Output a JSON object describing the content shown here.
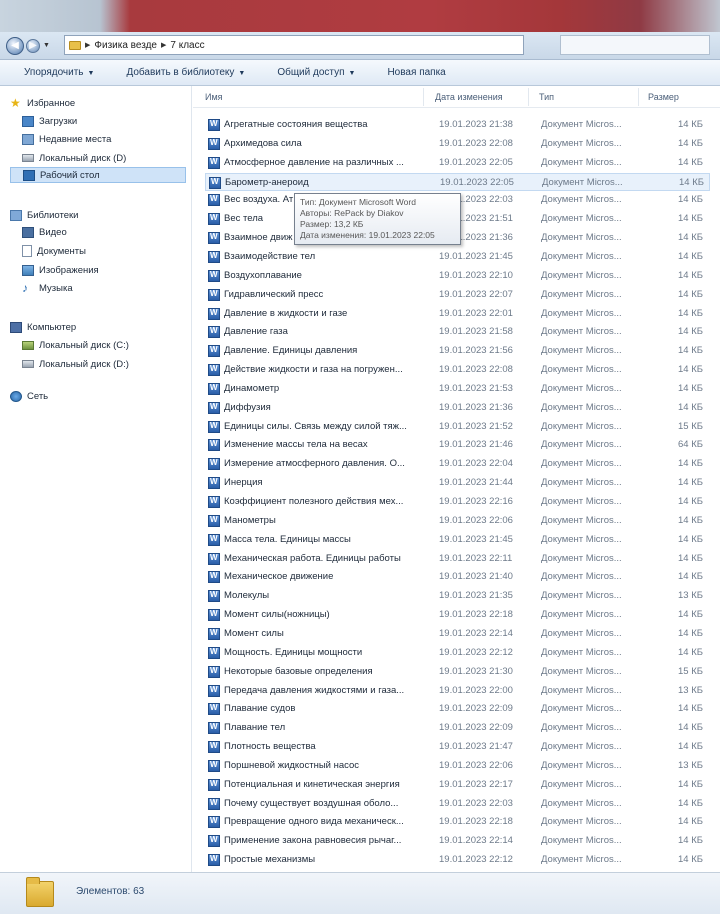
{
  "breadcrumb": {
    "parts": [
      "Физика везде",
      "7 класс"
    ]
  },
  "toolbar": {
    "organize": "Упорядочить",
    "add_library": "Добавить в библиотеку",
    "share": "Общий доступ",
    "new_folder": "Новая папка"
  },
  "sidebar": {
    "favorites": {
      "header": "Избранное",
      "items": [
        "Загрузки",
        "Недавние места",
        "Локальный диск (D)",
        "Рабочий стол"
      ]
    },
    "libraries": {
      "header": "Библиотеки",
      "items": [
        "Видео",
        "Документы",
        "Изображения",
        "Музыка"
      ]
    },
    "computer": {
      "header": "Компьютер",
      "items": [
        "Локальный диск (C:)",
        "Локальный диск (D:)"
      ]
    },
    "network": {
      "header": "Сеть"
    }
  },
  "columns": {
    "name": "Имя",
    "date": "Дата изменения",
    "type": "Тип",
    "size": "Размер"
  },
  "files": [
    {
      "name": "Агрегатные состояния вещества",
      "date": "19.01.2023 21:38",
      "type": "Документ Micros...",
      "size": "14 КБ"
    },
    {
      "name": "Архимедова сила",
      "date": "19.01.2023 22:08",
      "type": "Документ Micros...",
      "size": "14 КБ"
    },
    {
      "name": "Атмосферное давление на различных ...",
      "date": "19.01.2023 22:05",
      "type": "Документ Micros...",
      "size": "14 КБ"
    },
    {
      "name": "Барометр-анероид",
      "date": "19.01.2023 22:05",
      "type": "Документ Micros...",
      "size": "14 КБ"
    },
    {
      "name": "Вес воздуха. Ат",
      "date": "19.01.2023 22:03",
      "type": "Документ Micros...",
      "size": "14 КБ"
    },
    {
      "name": "Вес тела",
      "date": "19.01.2023 21:51",
      "type": "Документ Micros...",
      "size": "14 КБ"
    },
    {
      "name": "Взаимное движ",
      "date": "19.01.2023 21:36",
      "type": "Документ Micros...",
      "size": "14 КБ"
    },
    {
      "name": "Взаимодействие тел",
      "date": "19.01.2023 21:45",
      "type": "Документ Micros...",
      "size": "14 КБ"
    },
    {
      "name": "Воздухоплавание",
      "date": "19.01.2023 22:10",
      "type": "Документ Micros...",
      "size": "14 КБ"
    },
    {
      "name": "Гидравлический пресс",
      "date": "19.01.2023 22:07",
      "type": "Документ Micros...",
      "size": "14 КБ"
    },
    {
      "name": "Давление в жидкости и газе",
      "date": "19.01.2023 22:01",
      "type": "Документ Micros...",
      "size": "14 КБ"
    },
    {
      "name": "Давление газа",
      "date": "19.01.2023 21:58",
      "type": "Документ Micros...",
      "size": "14 КБ"
    },
    {
      "name": "Давление. Единицы давления",
      "date": "19.01.2023 21:56",
      "type": "Документ Micros...",
      "size": "14 КБ"
    },
    {
      "name": "Действие жидкости и газа на погружен...",
      "date": "19.01.2023 22:08",
      "type": "Документ Micros...",
      "size": "14 КБ"
    },
    {
      "name": "Динамометр",
      "date": "19.01.2023 21:53",
      "type": "Документ Micros...",
      "size": "14 КБ"
    },
    {
      "name": "Диффузия",
      "date": "19.01.2023 21:36",
      "type": "Документ Micros...",
      "size": "14 КБ"
    },
    {
      "name": "Единицы силы. Связь между силой тяж...",
      "date": "19.01.2023 21:52",
      "type": "Документ Micros...",
      "size": "15 КБ"
    },
    {
      "name": "Изменение массы тела на весах",
      "date": "19.01.2023 21:46",
      "type": "Документ Micros...",
      "size": "64 КБ"
    },
    {
      "name": "Измерение атмосферного давления. О...",
      "date": "19.01.2023 22:04",
      "type": "Документ Micros...",
      "size": "14 КБ"
    },
    {
      "name": "Инерция",
      "date": "19.01.2023 21:44",
      "type": "Документ Micros...",
      "size": "14 КБ"
    },
    {
      "name": "Коэффициент полезного действия мех...",
      "date": "19.01.2023 22:16",
      "type": "Документ Micros...",
      "size": "14 КБ"
    },
    {
      "name": "Манометры",
      "date": "19.01.2023 22:06",
      "type": "Документ Micros...",
      "size": "14 КБ"
    },
    {
      "name": "Масса тела. Единицы массы",
      "date": "19.01.2023 21:45",
      "type": "Документ Micros...",
      "size": "14 КБ"
    },
    {
      "name": "Механическая работа. Единицы работы",
      "date": "19.01.2023 22:11",
      "type": "Документ Micros...",
      "size": "14 КБ"
    },
    {
      "name": "Механическое движение",
      "date": "19.01.2023 21:40",
      "type": "Документ Micros...",
      "size": "14 КБ"
    },
    {
      "name": "Молекулы",
      "date": "19.01.2023 21:35",
      "type": "Документ Micros...",
      "size": "13 КБ"
    },
    {
      "name": "Момент силы(ножницы)",
      "date": "19.01.2023 22:18",
      "type": "Документ Micros...",
      "size": "14 КБ"
    },
    {
      "name": "Момент силы",
      "date": "19.01.2023 22:14",
      "type": "Документ Micros...",
      "size": "14 КБ"
    },
    {
      "name": "Мощность. Единицы мощности",
      "date": "19.01.2023 22:12",
      "type": "Документ Micros...",
      "size": "14 КБ"
    },
    {
      "name": "Некоторые базовые определения",
      "date": "19.01.2023 21:30",
      "type": "Документ Micros...",
      "size": "15 КБ"
    },
    {
      "name": "Передача давления жидкостями и газа...",
      "date": "19.01.2023 22:00",
      "type": "Документ Micros...",
      "size": "13 КБ"
    },
    {
      "name": "Плавание судов",
      "date": "19.01.2023 22:09",
      "type": "Документ Micros...",
      "size": "14 КБ"
    },
    {
      "name": "Плавание тел",
      "date": "19.01.2023 22:09",
      "type": "Документ Micros...",
      "size": "14 КБ"
    },
    {
      "name": "Плотность вещества",
      "date": "19.01.2023 21:47",
      "type": "Документ Micros...",
      "size": "14 КБ"
    },
    {
      "name": "Поршневой жидкостный насос",
      "date": "19.01.2023 22:06",
      "type": "Документ Micros...",
      "size": "13 КБ"
    },
    {
      "name": "Потенциальная и кинетическая энергия",
      "date": "19.01.2023 22:17",
      "type": "Документ Micros...",
      "size": "14 КБ"
    },
    {
      "name": "Почему существует воздушная оболо...",
      "date": "19.01.2023 22:03",
      "type": "Документ Micros...",
      "size": "14 КБ"
    },
    {
      "name": "Превращение одного вида механическ...",
      "date": "19.01.2023 22:18",
      "type": "Документ Micros...",
      "size": "14 КБ"
    },
    {
      "name": "Применение закона равновесия рычаг...",
      "date": "19.01.2023 22:14",
      "type": "Документ Micros...",
      "size": "14 КБ"
    },
    {
      "name": "Простые механизмы",
      "date": "19.01.2023 22:12",
      "type": "Документ Micros...",
      "size": "14 КБ"
    },
    {
      "name": "Равенство работ при использовании п...",
      "date": "19.01.2023 22:16",
      "type": "Документ Micros...",
      "size": "14 КБ"
    }
  ],
  "tooltip": {
    "type": "Тип: Документ Microsoft Word",
    "authors": "Авторы: RePack by Diakov",
    "size": "Размер: 13,2 КБ",
    "modified": "Дата изменения: 19.01.2023 22:05"
  },
  "status": {
    "count": "Элементов: 63"
  },
  "colors": {
    "accent_title": "#b03c41",
    "selection": "#cfe3f8",
    "link_text": "#1e395b"
  }
}
